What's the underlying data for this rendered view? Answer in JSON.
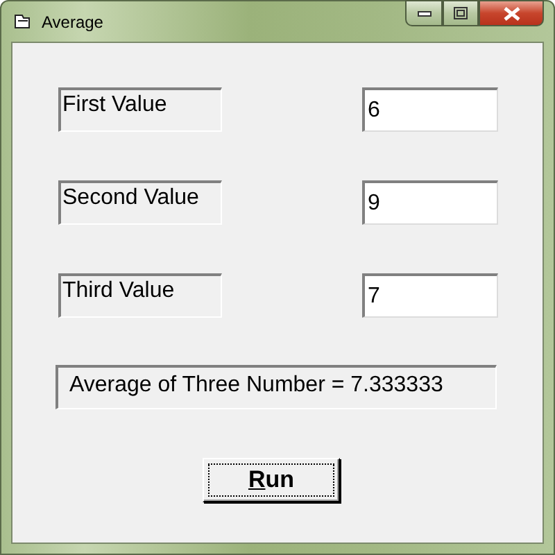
{
  "window": {
    "title": "Average"
  },
  "rows": [
    {
      "label": "First Value",
      "value": "6"
    },
    {
      "label": "Second Value",
      "value": "9"
    },
    {
      "label": "Third Value",
      "value": "7"
    }
  ],
  "result": "Average of Three Number = 7.333333",
  "run_button": {
    "label": "Run",
    "underline_first": true,
    "focused": true
  }
}
